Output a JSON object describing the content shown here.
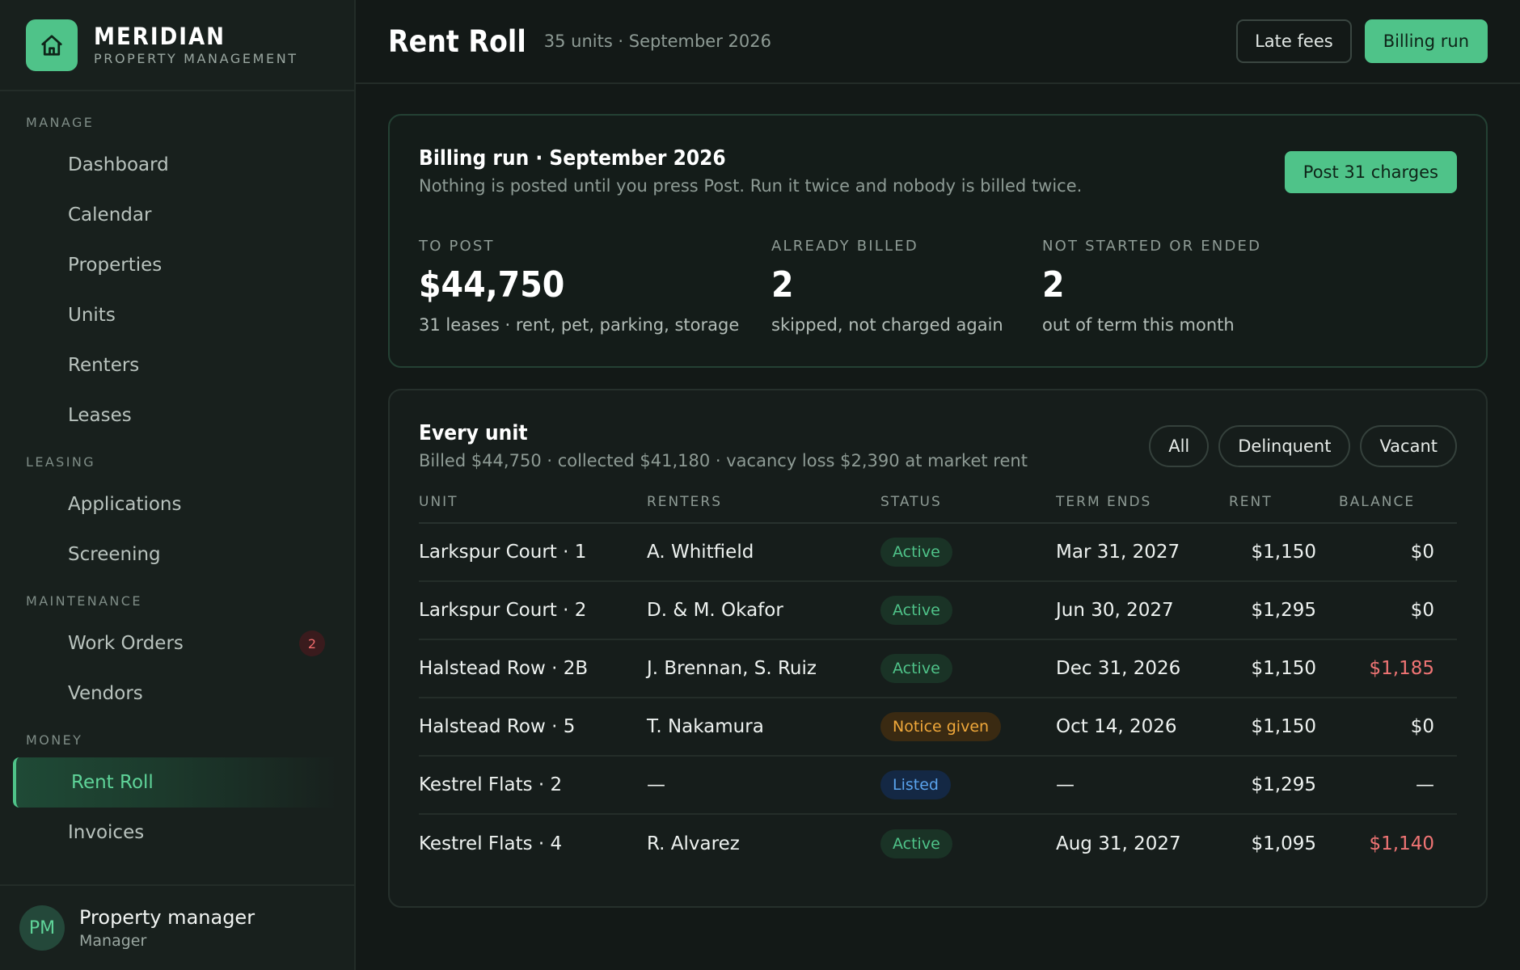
{
  "brand": {
    "name": "MERIDIAN",
    "subtitle": "PROPERTY MANAGEMENT",
    "logo_icon": "home-icon"
  },
  "nav": {
    "sections": [
      {
        "title": "MANAGE",
        "items": [
          "Dashboard",
          "Calendar",
          "Properties",
          "Units",
          "Renters",
          "Leases"
        ]
      },
      {
        "title": "LEASING",
        "items": [
          "Applications",
          "Screening"
        ]
      },
      {
        "title": "MAINTENANCE",
        "items": [
          "Work Orders",
          "Vendors"
        ],
        "badge": "2"
      },
      {
        "title": "MONEY",
        "items": [
          "Rent Roll",
          "Invoices"
        ],
        "active": "Rent Roll"
      }
    ]
  },
  "user": {
    "initials": "PM",
    "name": "Property manager",
    "role": "Manager"
  },
  "header": {
    "title": "Rent Roll",
    "subtitle": "35 units · September 2026",
    "late_fees_label": "Late fees",
    "billing_run_label": "Billing run"
  },
  "billing": {
    "title": "Billing run · September 2026",
    "description": "Nothing is posted until you press Post. Run it twice and nobody is billed twice.",
    "post_label": "Post 31 charges",
    "stats": [
      {
        "label": "TO POST",
        "value": "$44,750",
        "note": "31 leases · rent, pet, parking, storage"
      },
      {
        "label": "ALREADY BILLED",
        "value": "2",
        "note": "skipped, not charged again"
      },
      {
        "label": "NOT STARTED OR ENDED",
        "value": "2",
        "note": "out of term this month"
      }
    ]
  },
  "units": {
    "title": "Every unit",
    "summary": "Billed $44,750 · collected $41,180 · vacancy loss $2,390 at market rent",
    "filters": [
      "All",
      "Delinquent",
      "Vacant"
    ],
    "columns": [
      "UNIT",
      "RENTERS",
      "STATUS",
      "TERM ENDS",
      "RENT",
      "BALANCE"
    ],
    "rows": [
      {
        "unit": "Larkspur Court · 1",
        "renters": "A. Whitfield",
        "status": "Active",
        "term": "Mar 31, 2027",
        "rent": "$1,150",
        "balance": "$0"
      },
      {
        "unit": "Larkspur Court · 2",
        "renters": "D. & M. Okafor",
        "status": "Active",
        "term": "Jun 30, 2027",
        "rent": "$1,295",
        "balance": "$0"
      },
      {
        "unit": "Halstead Row · 2B",
        "renters": "J. Brennan, S. Ruiz",
        "status": "Active",
        "term": "Dec 31, 2026",
        "rent": "$1,150",
        "balance": "$1,185"
      },
      {
        "unit": "Halstead Row · 5",
        "renters": "T. Nakamura",
        "status": "Notice given",
        "term": "Oct 14, 2026",
        "rent": "$1,150",
        "balance": "$0"
      },
      {
        "unit": "Kestrel Flats · 2",
        "renters": "—",
        "status": "Listed",
        "term": "—",
        "rent": "$1,295",
        "balance": "—"
      },
      {
        "unit": "Kestrel Flats · 4",
        "renters": "R. Alvarez",
        "status": "Active",
        "term": "Aug 31, 2027",
        "rent": "$1,095",
        "balance": "$1,140"
      }
    ]
  },
  "colors": {
    "accent": "#4fc389",
    "negative": "#ef7474",
    "notice": "#f0a83a",
    "listed": "#5aa3ec"
  }
}
